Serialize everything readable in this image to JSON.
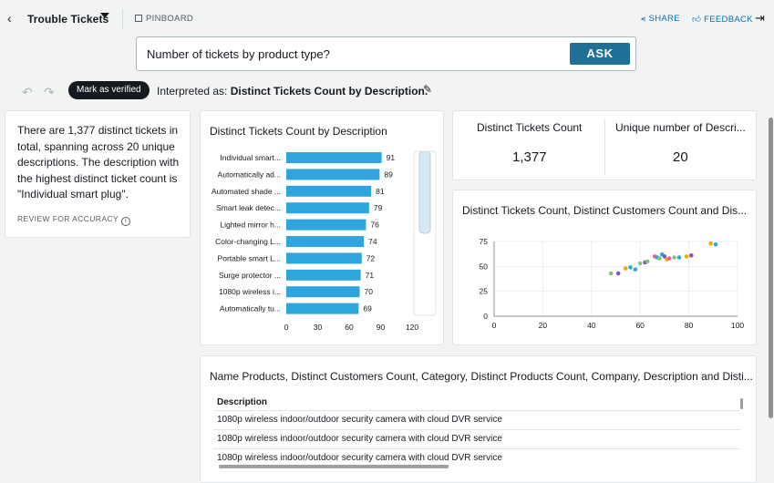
{
  "header": {
    "title": "Trouble Tickets",
    "pinboard": "PINBOARD",
    "share": "SHARE",
    "feedback": "FEEDBACK"
  },
  "ask": {
    "query": "Number of tickets by product type?",
    "button": "ASK"
  },
  "interpretation": {
    "verified_label": "Mark as verified",
    "prefix": "Interpreted as: ",
    "value": "Distinct Tickets Count by Description."
  },
  "summary": {
    "text": "There are 1,377 distinct tickets in total, spanning across 20 unique descriptions. The description with the highest distinct ticket count is \"Individual smart plug\".",
    "review": "REVIEW FOR ACCURACY"
  },
  "kpis": [
    {
      "label": "Distinct Tickets Count",
      "value": "1,377"
    },
    {
      "label": "Unique number of Descri...",
      "value": "20"
    }
  ],
  "chart_data": [
    {
      "type": "bar",
      "title": "Distinct Tickets Count by Description",
      "orientation": "horizontal",
      "categories": [
        "Individual smart...",
        "Automatically ad...",
        "Automated shade ...",
        "Smart leak detec...",
        "Lighted mirror h...",
        "Color-changing L...",
        "Portable smart L...",
        "Surge protector ...",
        "1080p wireless i...",
        "Automatically tu..."
      ],
      "values": [
        91,
        89,
        81,
        79,
        76,
        74,
        72,
        71,
        70,
        69
      ],
      "xlim": [
        0,
        120
      ],
      "xticks": [
        "0",
        "30",
        "60",
        "90",
        "120"
      ],
      "color": "#2ea5dd"
    },
    {
      "type": "scatter",
      "title": "Distinct Tickets Count, Distinct Customers Count and Dis...",
      "xlim": [
        0,
        100
      ],
      "ylim": [
        0,
        75
      ],
      "xticks": [
        "0",
        "20",
        "40",
        "60",
        "80",
        "100"
      ],
      "yticks": [
        "0",
        "25",
        "50",
        "75"
      ],
      "points": [
        {
          "x": 48,
          "y": 43,
          "color": "#86c27e"
        },
        {
          "x": 51,
          "y": 43,
          "color": "#7b5bb5"
        },
        {
          "x": 54,
          "y": 48,
          "color": "#f2a900"
        },
        {
          "x": 56,
          "y": 49,
          "color": "#2ea5dd"
        },
        {
          "x": 58,
          "y": 47,
          "color": "#2ea5dd"
        },
        {
          "x": 60,
          "y": 53,
          "color": "#86c27e"
        },
        {
          "x": 62,
          "y": 54,
          "color": "#7b5bb5"
        },
        {
          "x": 63,
          "y": 55,
          "color": "#86c27e"
        },
        {
          "x": 66,
          "y": 60,
          "color": "#e4669a"
        },
        {
          "x": 67,
          "y": 59,
          "color": "#2ea5dd"
        },
        {
          "x": 68,
          "y": 58,
          "color": "#86c27e"
        },
        {
          "x": 69,
          "y": 62,
          "color": "#2ea5dd"
        },
        {
          "x": 70,
          "y": 60,
          "color": "#7b5bb5"
        },
        {
          "x": 71,
          "y": 57,
          "color": "#f2a900"
        },
        {
          "x": 72,
          "y": 58,
          "color": "#e4669a"
        },
        {
          "x": 74,
          "y": 59,
          "color": "#86c27e"
        },
        {
          "x": 76,
          "y": 59,
          "color": "#2ea5dd"
        },
        {
          "x": 79,
          "y": 60,
          "color": "#f2a900"
        },
        {
          "x": 81,
          "y": 61,
          "color": "#7b5bb5"
        },
        {
          "x": 89,
          "y": 73,
          "color": "#f2a900"
        },
        {
          "x": 91,
          "y": 72,
          "color": "#2ea5dd"
        }
      ]
    }
  ],
  "table": {
    "title": "Name Products, Distinct Customers Count, Category, Distinct Products Count, Company, Description and Disti...",
    "column": "Description",
    "rows": [
      "1080p wireless indoor/outdoor security camera with cloud DVR service",
      "1080p wireless indoor/outdoor security camera with cloud DVR service",
      "1080p wireless indoor/outdoor security camera with cloud DVR service"
    ]
  }
}
